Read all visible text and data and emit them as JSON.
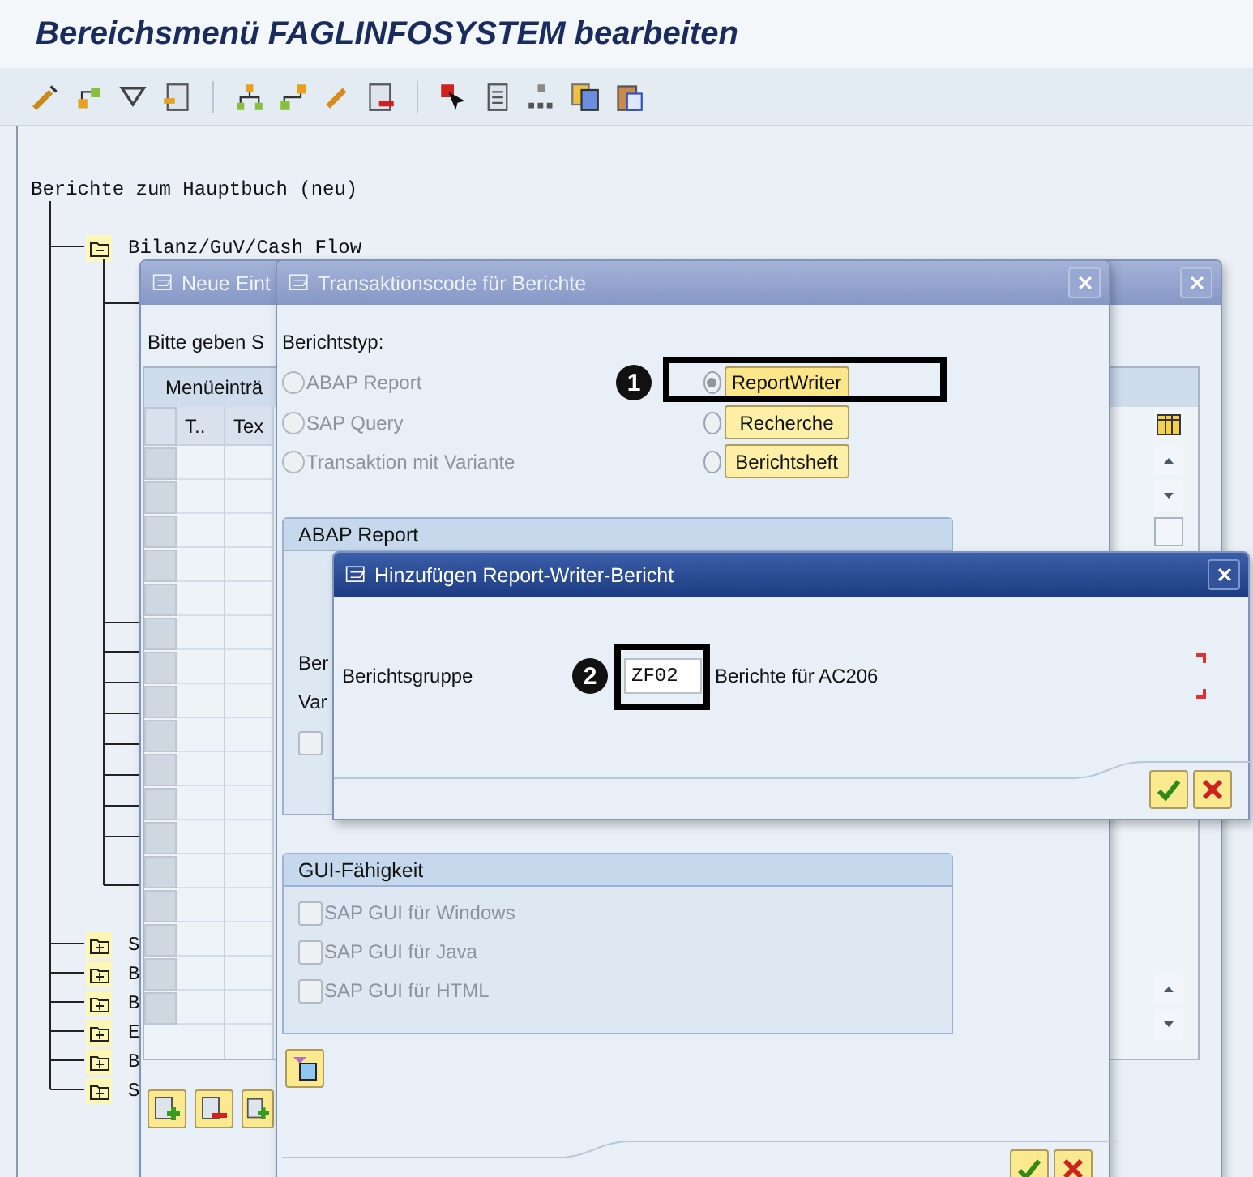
{
  "window": {
    "title": "Bereichsmenü FAGLINFOSYSTEM bearbeiten"
  },
  "tree": {
    "root": "Berichte zum Hauptbuch (neu)",
    "children": [
      {
        "label": "Bilanz/GuV/Cash Flow",
        "expanded": true
      },
      {
        "label": "S",
        "expanded": false
      },
      {
        "label": "B",
        "expanded": false
      },
      {
        "label": "B",
        "expanded": false
      },
      {
        "label": "E",
        "expanded": false
      },
      {
        "label": "B",
        "expanded": false
      },
      {
        "label": "S",
        "expanded": false
      }
    ]
  },
  "entry_dialog": {
    "title": "Neue Eint",
    "prompt": "Bitte geben S",
    "table_title": "Menüeinträ",
    "columns": [
      "T..",
      "Tex"
    ]
  },
  "transaction_dialog": {
    "title": "Transaktionscode für Berichte",
    "report_type_label": "Berichtstyp:",
    "report_types": [
      {
        "label": "ABAP Report",
        "selected": false,
        "disabled": true
      },
      {
        "label": "SAP Query",
        "selected": false,
        "disabled": true
      },
      {
        "label": "Transaktion mit Variante",
        "selected": false,
        "disabled": true
      }
    ],
    "writer_types": [
      {
        "label": "ReportWriter",
        "selected": true,
        "callout": "1"
      },
      {
        "label": "Recherche",
        "selected": false
      },
      {
        "label": "Berichtsheft",
        "selected": false
      }
    ],
    "abap_group": {
      "title": "ABAP Report",
      "fields": [
        "Ber",
        "Var"
      ],
      "checkbox": {
        "checked": false,
        "disabled": true
      }
    },
    "gui_group": {
      "title": "GUI-Fähigkeit",
      "checkboxes": [
        {
          "label": "SAP GUI für Windows",
          "checked": false,
          "disabled": true
        },
        {
          "label": "SAP GUI für Java",
          "checked": false,
          "disabled": true
        },
        {
          "label": "SAP GUI für HTML",
          "checked": false,
          "disabled": true
        }
      ]
    }
  },
  "add_dialog": {
    "title": "Hinzufügen Report-Writer-Bericht",
    "field_label": "Berichtsgruppe",
    "callout": "2",
    "value": "ZF02",
    "description": "Berichte für AC206"
  }
}
